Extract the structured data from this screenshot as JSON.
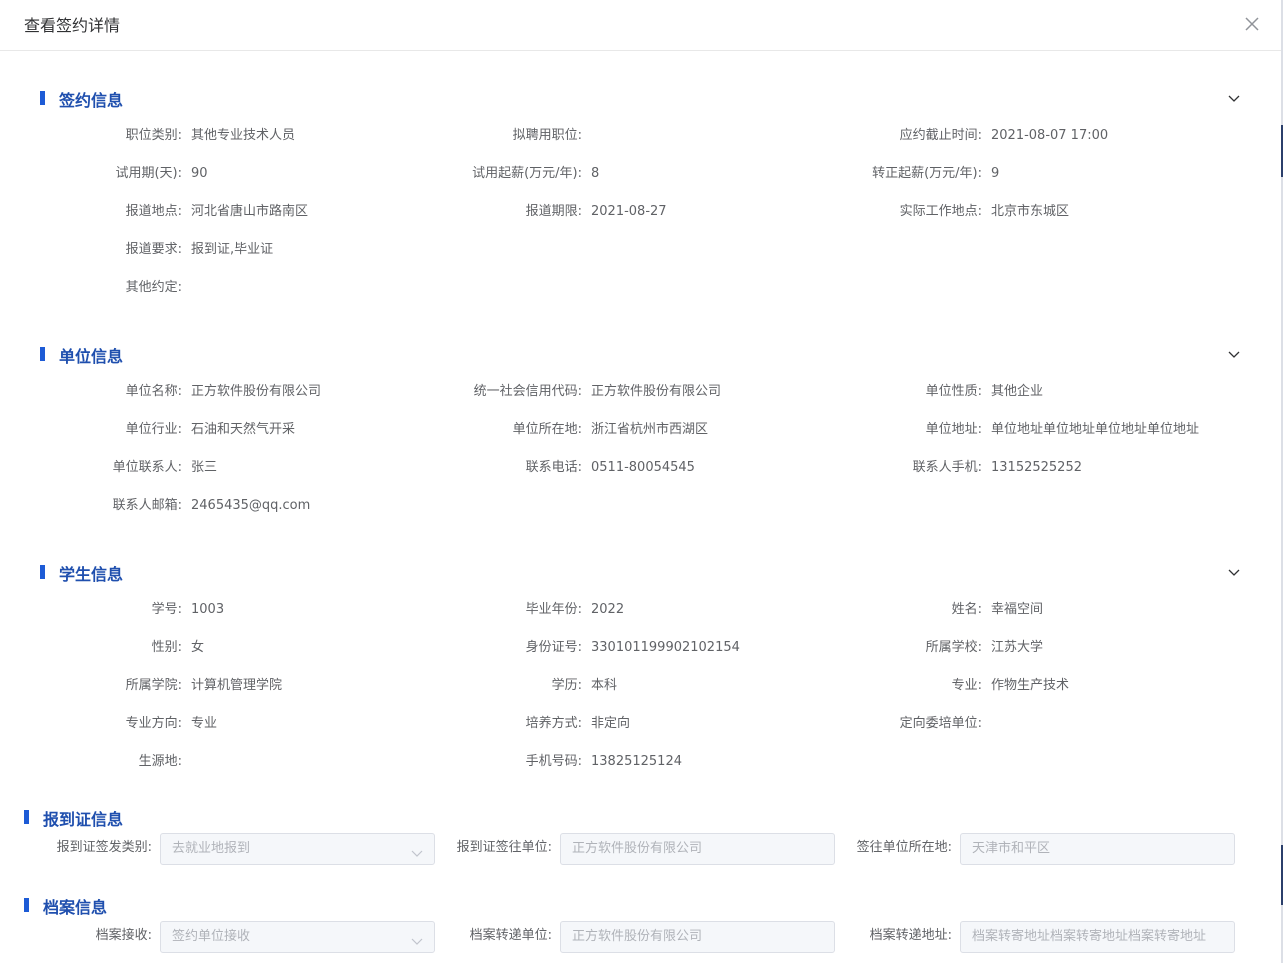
{
  "dialog": {
    "title": "查看签约详情"
  },
  "sections": {
    "sign": {
      "title": "签约信息"
    },
    "unit": {
      "title": "单位信息"
    },
    "student": {
      "title": "学生信息"
    },
    "report": {
      "title": "报到证信息"
    },
    "archive": {
      "title": "档案信息"
    }
  },
  "sign": {
    "category_label": "职位类别:",
    "category": "其他专业技术人员",
    "position_label": "拟聘用职位:",
    "position": "",
    "deadline_label": "应约截止时间:",
    "deadline": "2021-08-07 17:00",
    "probation_label": "试用期(天):",
    "probation": "90",
    "trial_salary_label": "试用起薪(万元/年):",
    "trial_salary": "8",
    "regular_salary_label": "转正起薪(万元/年):",
    "regular_salary": "9",
    "report_place_label": "报道地点:",
    "report_place": "河北省唐山市路南区",
    "report_deadline_label": "报道期限:",
    "report_deadline": "2021-08-27",
    "work_place_label": "实际工作地点:",
    "work_place": "北京市东城区",
    "report_req_label": "报道要求:",
    "report_req": "报到证,毕业证",
    "other_label": "其他约定:",
    "other": ""
  },
  "unit": {
    "name_label": "单位名称:",
    "name": "正方软件股份有限公司",
    "credit_label": "统一社会信用代码:",
    "credit": "正方软件股份有限公司",
    "nature_label": "单位性质:",
    "nature": "其他企业",
    "industry_label": "单位行业:",
    "industry": "石油和天然气开采",
    "location_label": "单位所在地:",
    "location": "浙江省杭州市西湖区",
    "address_label": "单位地址:",
    "address": "单位地址单位地址单位地址单位地址",
    "contact_label": "单位联系人:",
    "contact": "张三",
    "phone_label": "联系电话:",
    "phone": "0511-80054545",
    "mobile_label": "联系人手机:",
    "mobile": "13152525252",
    "email_label": "联系人邮箱:",
    "email": "2465435@qq.com"
  },
  "student": {
    "id_label": "学号:",
    "id": "1003",
    "grad_year_label": "毕业年份:",
    "grad_year": "2022",
    "name_label": "姓名:",
    "name": "幸福空间",
    "gender_label": "性别:",
    "gender": "女",
    "idcard_label": "身份证号:",
    "idcard": "330101199902102154",
    "school_label": "所属学校:",
    "school": "江苏大学",
    "college_label": "所属学院:",
    "college": "计算机管理学院",
    "degree_label": "学历:",
    "degree": "本科",
    "major_label": "专业:",
    "major": "作物生产技术",
    "direction_label": "专业方向:",
    "direction": "专业",
    "training_label": "培养方式:",
    "training": "非定向",
    "entrust_label": "定向委培单位:",
    "entrust": "",
    "origin_label": "生源地:",
    "origin": "",
    "mobile_label": "手机号码:",
    "mobile": "13825125124"
  },
  "report": {
    "type_label": "报到证签发类别:",
    "type": "去就业地报到",
    "unit_label": "报到证签往单位:",
    "unit": "正方软件股份有限公司",
    "loc_label": "签往单位所在地:",
    "loc": "天津市和平区"
  },
  "archive": {
    "receive_label": "档案接收:",
    "receive": "签约单位接收",
    "unit_label": "档案转递单位:",
    "unit": "正方软件股份有限公司",
    "addr_label": "档案转递地址:",
    "addr": "档案转寄地址档案转寄地址档案转寄地址"
  }
}
